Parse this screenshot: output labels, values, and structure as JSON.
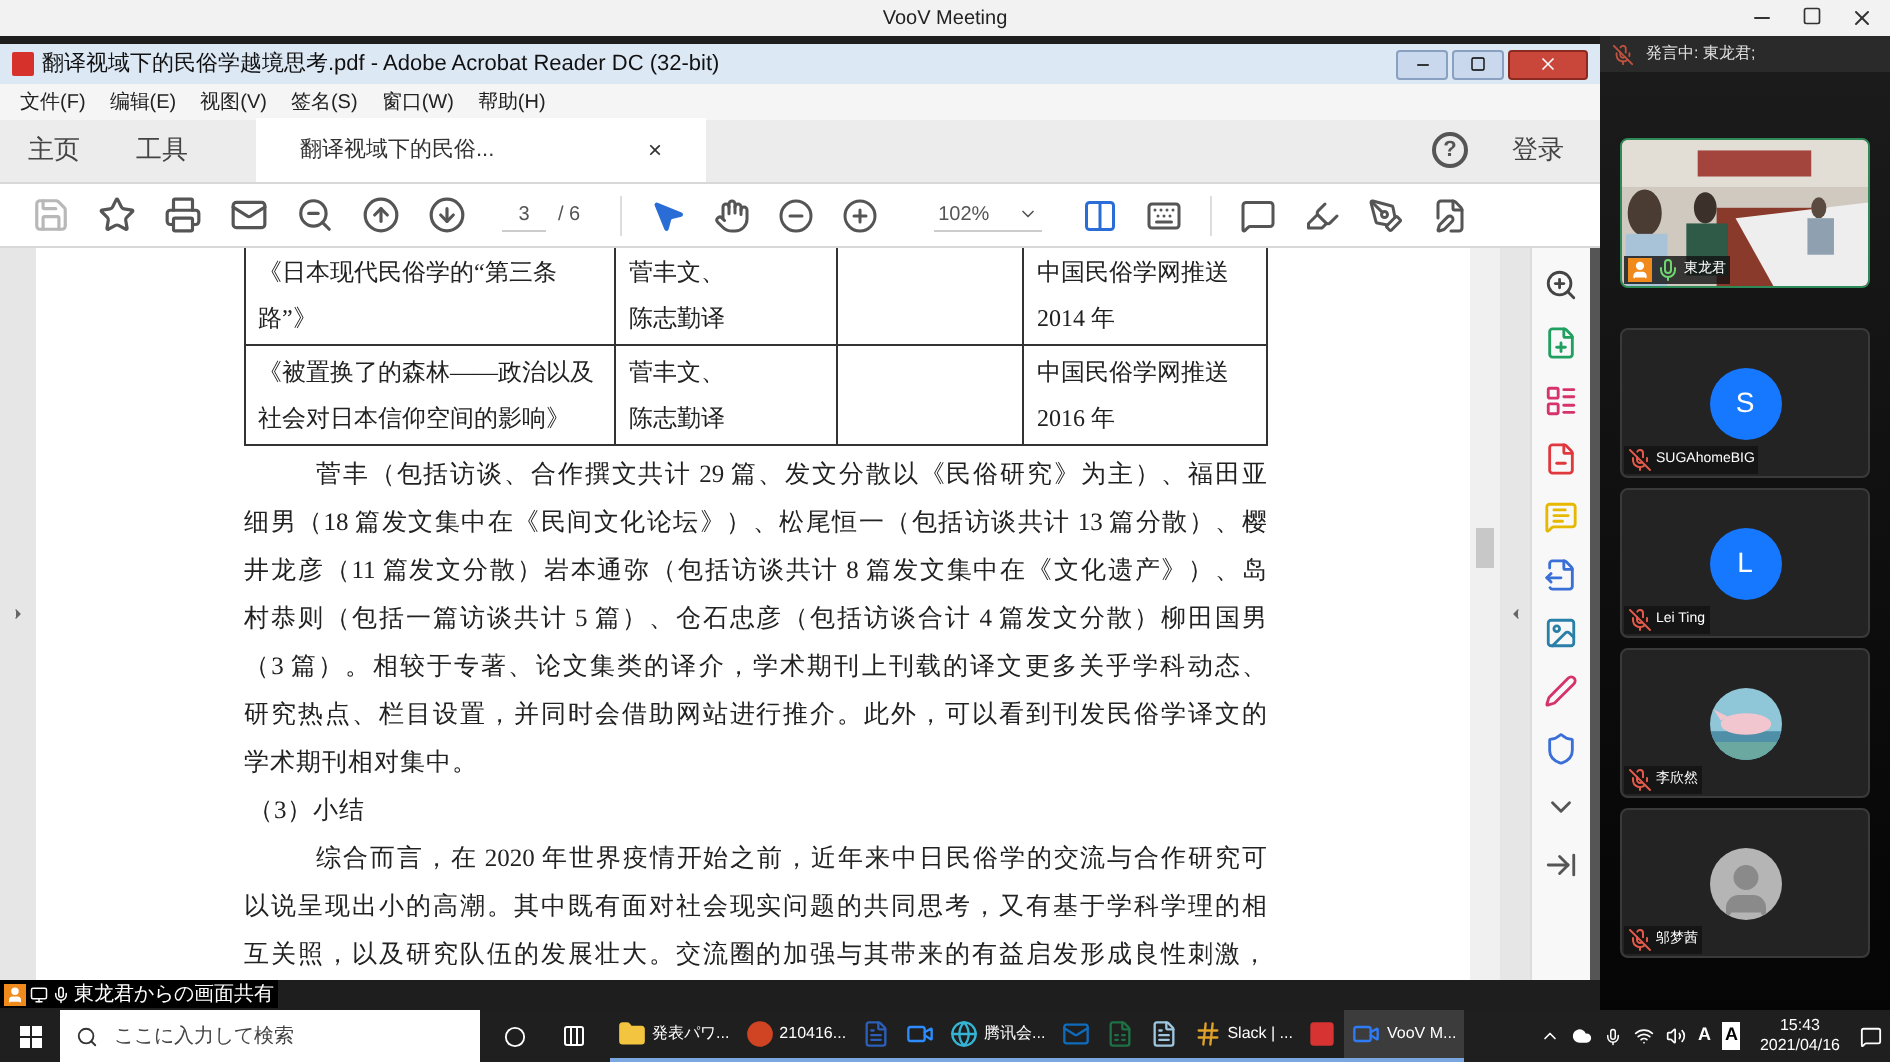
{
  "meeting_window": {
    "title": "VooV Meeting"
  },
  "acrobat": {
    "title": "翻译视域下的民俗学越境思考.pdf - Adobe Acrobat Reader DC (32-bit)",
    "menu": [
      "文件(F)",
      "编辑(E)",
      "视图(V)",
      "签名(S)",
      "窗口(W)",
      "帮助(H)"
    ],
    "nav_tabs": [
      {
        "label": "主页",
        "selected": false
      },
      {
        "label": "工具",
        "selected": false
      },
      {
        "label": "翻译视域下的民俗...",
        "selected": true,
        "close": "×"
      }
    ],
    "help": "?",
    "login": "登录",
    "page_current": "3",
    "page_total": "/ 6",
    "zoom": "102%",
    "table": {
      "rows": [
        [
          [
            "《日本现代民俗学的“第三条",
            "路”》"
          ],
          [
            "菅丰文、",
            "陈志勤译"
          ],
          [],
          [
            "中国民俗学网推送",
            "2014 年"
          ]
        ],
        [
          [
            "《被置换了的森林——政治以及",
            "社会对日本信仰空间的影响》"
          ],
          [
            "菅丰文、",
            "陈志勤译"
          ],
          [],
          [
            "中国民俗学网推送",
            "2016 年"
          ]
        ]
      ]
    },
    "paragraphs": [
      {
        "kind": "body",
        "lines": [
          "菅丰（包括访谈、合作撰文共计 29 篇、发文分散以《民俗研究》为主）、福田亚",
          "细男（18 篇发文集中在《民间文化论坛》）、松尾恒一（包括访谈共计 13 篇分散）、樱",
          "井龙彦（11 篇发文分散）岩本通弥（包括访谈共计 8 篇发文集中在《文化遗产》）、岛",
          "村恭则（包括一篇访谈共计 5 篇）、仓石忠彦（包括访谈合计 4 篇发文分散）柳田国男",
          "（3 篇）。相较于专著、论文集类的译介，学术期刊上刊载的译文更多关乎学科动态、",
          "研究热点、栏目设置，并同时会借助网站进行推介。此外，可以看到刊发民俗学译文的",
          "学术期刊相对集中。"
        ]
      },
      {
        "kind": "heading",
        "lines": [
          "（3）小结"
        ]
      },
      {
        "kind": "body",
        "lines": [
          "综合而言，在 2020 年世界疫情开始之前，近年来中日民俗学的交流与合作研究可",
          "以说呈现出小的高潮。其中既有面对社会现实问题的共同思考，又有基于学科学理的相",
          "互关照，以及研究队伍的发展壮大。交流圈的加强与其带来的有益启发形成良性刺激，"
        ]
      }
    ]
  },
  "share_banner": "東龙君からの画面共有",
  "meeting_panel": {
    "speaking": "発言中: 東龙君;",
    "participants": [
      {
        "kind": "video",
        "name": "東龙君",
        "muted": false
      },
      {
        "kind": "initial",
        "initial": "S",
        "name": "SUGAhomeBIG",
        "muted": true
      },
      {
        "kind": "initial",
        "initial": "L",
        "name": "Lei Ting",
        "muted": true
      },
      {
        "name": "李欣然",
        "muted": true
      },
      {
        "kind": "default",
        "name": "邬梦茜",
        "muted": true
      }
    ]
  },
  "taskbar": {
    "search_placeholder": "ここに入力して検索",
    "apps": [
      {
        "kind": "folder",
        "label": "発表パワ...",
        "selected": false
      },
      {
        "kind": "powerpoint",
        "label": "210416...",
        "selected": false
      },
      {
        "kind": "word",
        "selected": false
      },
      {
        "kind": "zoom",
        "selected": false
      },
      {
        "kind": "edge",
        "label": "腾讯会...",
        "selected": false
      },
      {
        "kind": "outlook",
        "selected": false
      },
      {
        "kind": "excel",
        "selected": false
      },
      {
        "kind": "notepad",
        "selected": false
      },
      {
        "kind": "slack",
        "label": "Slack | ...",
        "selected": false
      },
      {
        "kind": "red",
        "selected": false
      },
      {
        "kind": "voov",
        "label": "VooV M...",
        "selected": true
      }
    ],
    "tray_labels": [
      "A",
      "A"
    ],
    "time": "15:43",
    "date": "2021/04/16"
  }
}
